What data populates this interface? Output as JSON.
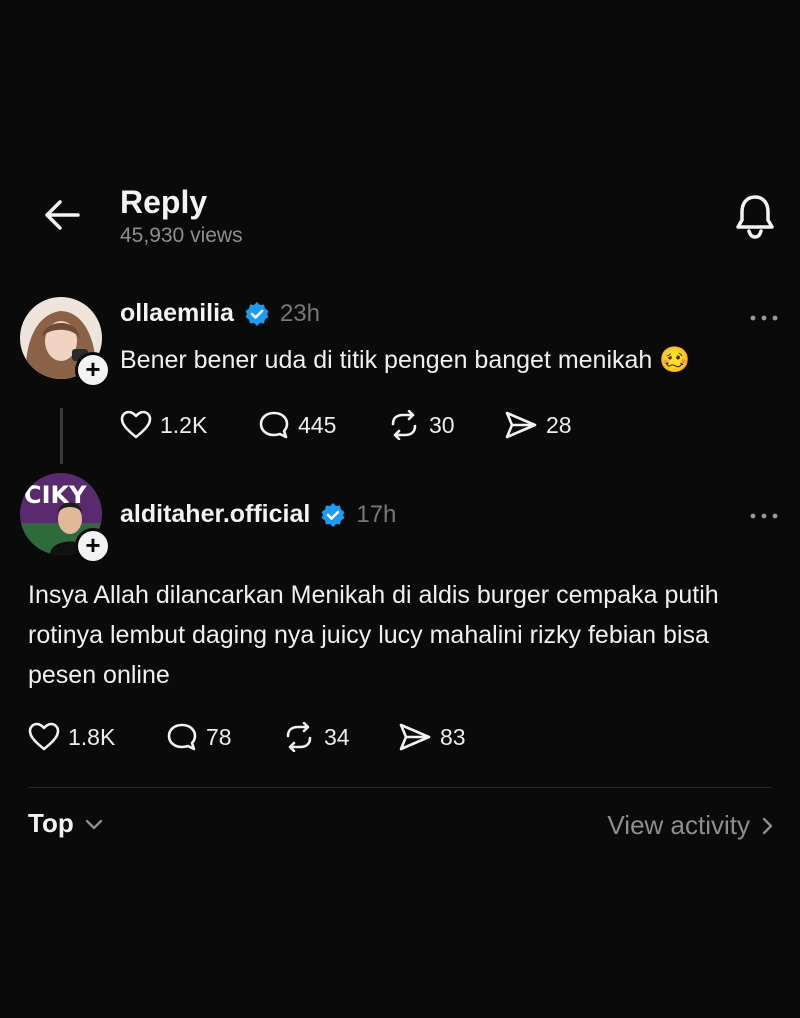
{
  "header": {
    "title": "Reply",
    "views": "45,930 views"
  },
  "post": {
    "username": "olla​emilia",
    "time": "23h",
    "text": "Bener bener uda di titik pengen banget menikah 🥴",
    "likes": "1.2K",
    "comments": "445",
    "reposts": "30",
    "shares": "28"
  },
  "reply": {
    "username": "alditaher.official",
    "time": "17h",
    "text": "Insya Allah dilancarkan Menikah di aldis burger cempaka putih rotinya lembut daging nya juicy lucy mahalini rizky febian bisa pesen online",
    "likes": "1.8K",
    "comments": "78",
    "reposts": "34",
    "shares": "83",
    "avatar_text": "CIKY"
  },
  "footer": {
    "sort_label": "Top",
    "activity_label": "View activity"
  },
  "icons": {
    "back": "arrow-left",
    "bell": "bell",
    "verified": "verified-badge",
    "like": "heart",
    "comment": "speech-bubble",
    "repost": "repost-arrows",
    "share": "paper-plane",
    "more": "ellipsis",
    "chevron_down": "chevron-down",
    "chevron_right": "chevron-right"
  },
  "colors": {
    "background": "#0a0a0a",
    "verified": "#1d9bf0",
    "muted": "#8e8e8e"
  }
}
